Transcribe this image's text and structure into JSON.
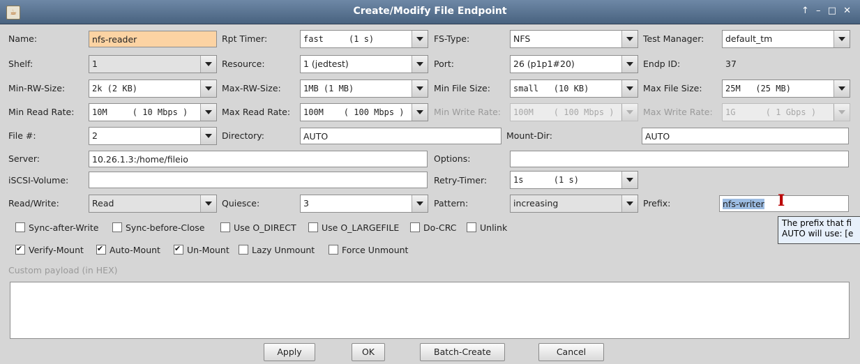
{
  "window": {
    "title": "Create/Modify File Endpoint",
    "controls": "↑ – □ ✕",
    "app_icon": "java-icon"
  },
  "form": {
    "name_label": "Name:",
    "name_value": "nfs-reader",
    "rpt_timer_label": "Rpt Timer:",
    "rpt_timer_value": "fast     (1 s)",
    "fs_type_label": "FS-Type:",
    "fs_type_value": "NFS",
    "test_manager_label": "Test Manager:",
    "test_manager_value": "default_tm",
    "shelf_label": "Shelf:",
    "shelf_value": "1",
    "resource_label": "Resource:",
    "resource_value": "1 (jedtest)",
    "port_label": "Port:",
    "port_value": "26 (p1p1#20)",
    "endp_id_label": "Endp ID:",
    "endp_id_value": "37",
    "min_rw_label": "Min-RW-Size:",
    "min_rw_value": "2k (2 KB)",
    "max_rw_label": "Max-RW-Size:",
    "max_rw_value": "1MB (1 MB)",
    "min_file_label": "Min File Size:",
    "min_file_value": "small   (10 KB)",
    "max_file_label": "Max File Size:",
    "max_file_value": "25M   (25 MB)",
    "min_read_label": "Min Read Rate:",
    "min_read_value": "10M     ( 10 Mbps )",
    "max_read_label": "Max Read Rate:",
    "max_read_value": "100M    ( 100 Mbps )",
    "min_write_label": "Min Write Rate:",
    "min_write_value": "100M    ( 100 Mbps )",
    "max_write_label": "Max Write Rate:",
    "max_write_value": "1G      ( 1 Gbps )",
    "file_num_label": "File #:",
    "file_num_value": "2",
    "directory_label": "Directory:",
    "directory_value": "AUTO",
    "mount_dir_label": "Mount-Dir:",
    "mount_dir_value": "AUTO",
    "server_label": "Server:",
    "server_value": "10.26.1.3:/home/fileio",
    "options_label": "Options:",
    "options_value": "",
    "iscsi_label": "iSCSI-Volume:",
    "iscsi_value": "",
    "retry_label": "Retry-Timer:",
    "retry_value": "1s      (1 s)",
    "rw_label": "Read/Write:",
    "rw_value": "Read",
    "quiesce_label": "Quiesce:",
    "quiesce_value": "3",
    "pattern_label": "Pattern:",
    "pattern_value": "increasing",
    "prefix_label": "Prefix:",
    "prefix_value": "nfs-writer"
  },
  "checks1": [
    {
      "label": "Sync-after-Write",
      "checked": false
    },
    {
      "label": "Sync-before-Close",
      "checked": false
    },
    {
      "label": "Use O_DIRECT",
      "checked": false
    },
    {
      "label": "Use O_LARGEFILE",
      "checked": false
    },
    {
      "label": "Do-CRC",
      "checked": false
    },
    {
      "label": "Unlink",
      "checked": false
    }
  ],
  "checks2": [
    {
      "label": "Verify-Mount",
      "checked": true
    },
    {
      "label": "Auto-Mount",
      "checked": true
    },
    {
      "label": "Un-Mount",
      "checked": true
    },
    {
      "label": "Lazy Unmount",
      "checked": false
    },
    {
      "label": "Force Unmount",
      "checked": false
    }
  ],
  "payload_label": "Custom payload (in HEX)",
  "payload_value": "",
  "buttons": {
    "apply": "Apply",
    "ok": "OK",
    "batch": "Batch-Create",
    "cancel": "Cancel"
  },
  "tooltip": {
    "line1": "The prefix that fi",
    "line2": "AUTO will use: [e"
  }
}
